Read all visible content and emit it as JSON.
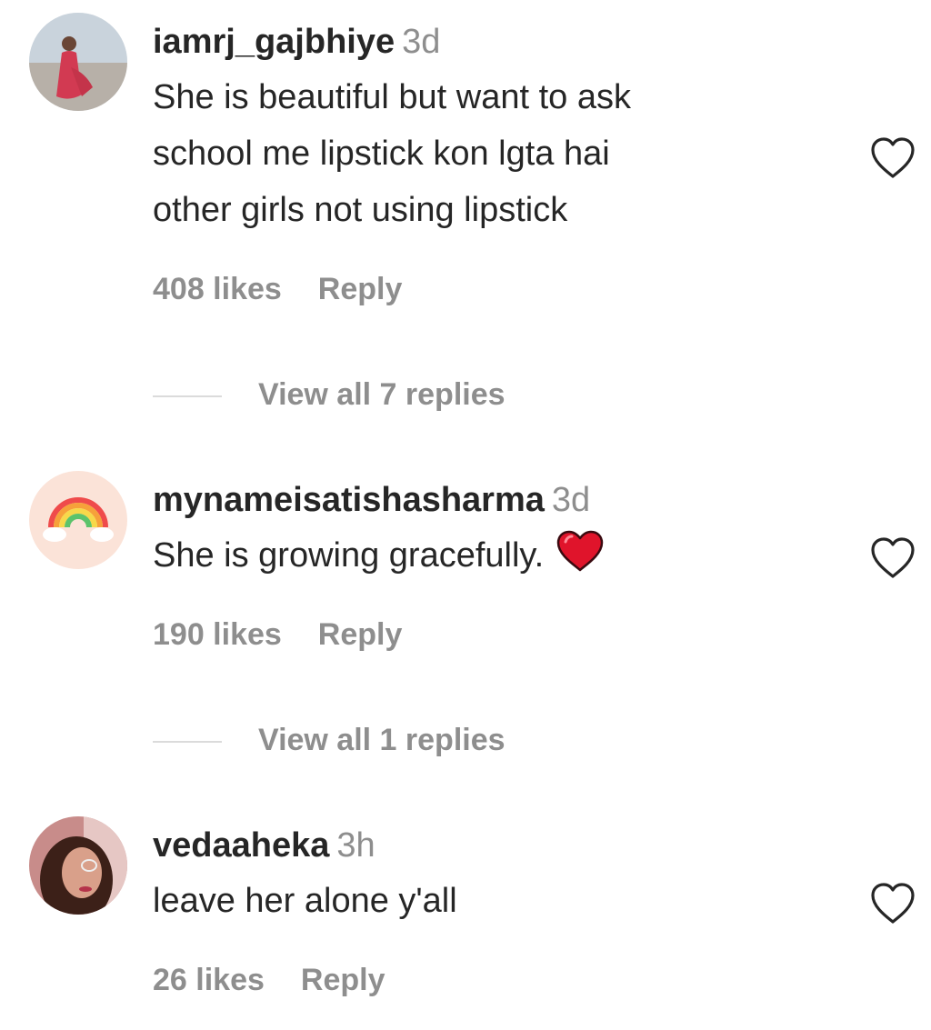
{
  "comments": [
    {
      "username": "iamrj_gajbhiye",
      "time": "3d",
      "lines": [
        "She is beautiful but want to ask",
        "school me lipstick kon lgta hai",
        "other girls not using lipstick"
      ],
      "likes": "408 likes",
      "reply_label": "Reply",
      "replies_label": "View all 7 replies"
    },
    {
      "username": "mynameisatishasharma",
      "time": "3d",
      "lines": [
        "She is growing gracefully."
      ],
      "likes": "190 likes",
      "reply_label": "Reply",
      "replies_label": "View all 1 replies"
    },
    {
      "username": "vedaaheka",
      "time": "3h",
      "lines": [
        "leave her alone y'all"
      ],
      "likes": "26 likes",
      "reply_label": "Reply"
    }
  ],
  "icons": {
    "like": "heart-outline-icon",
    "emoji": "red-heart-emoji-icon",
    "avatar2": "rainbow-icon"
  },
  "colors": {
    "text": "#262626",
    "secondary": "#8e8e8e",
    "emoji_heart": "#e0142b",
    "divider": "#dbdbdb"
  }
}
